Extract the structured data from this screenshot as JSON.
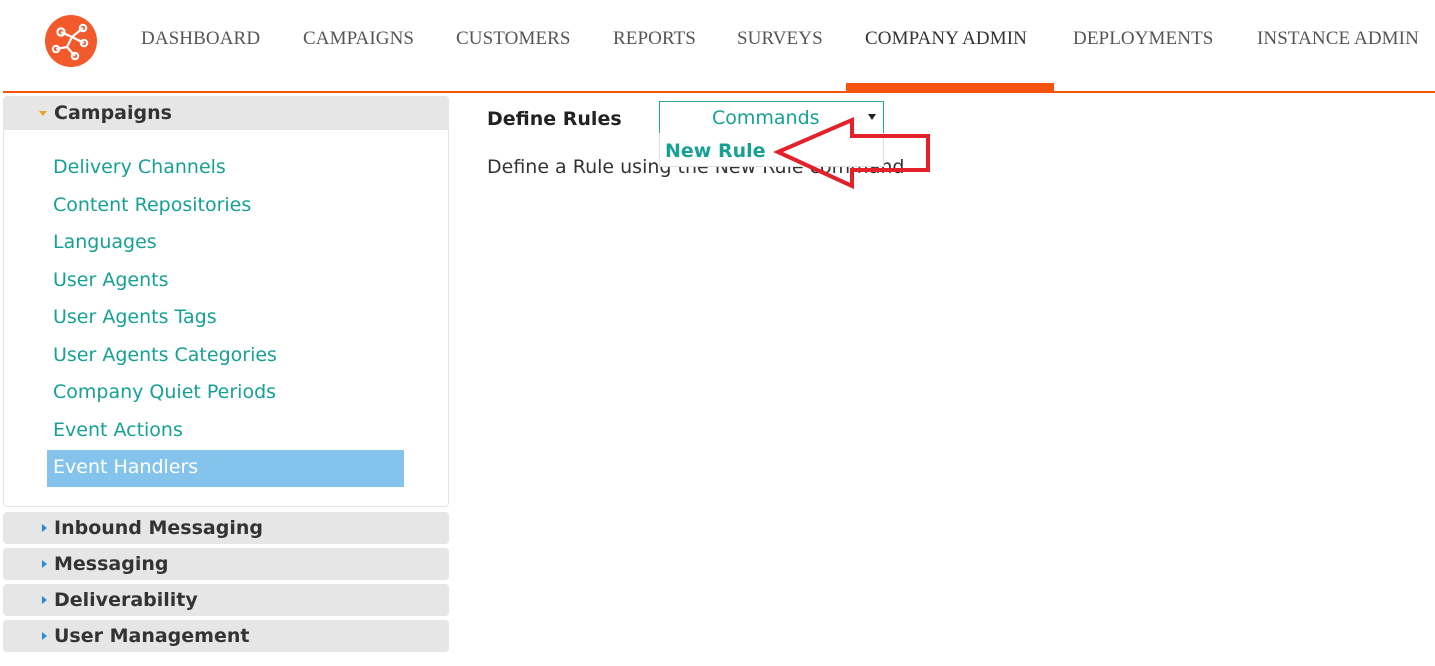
{
  "nav": {
    "items": [
      "DASHBOARD",
      "CAMPAIGNS",
      "CUSTOMERS",
      "REPORTS",
      "SURVEYS",
      "COMPANY ADMIN",
      "DEPLOYMENTS",
      "INSTANCE ADMIN"
    ],
    "active": "COMPANY ADMIN",
    "accent_color": "#f5520b"
  },
  "logo": {
    "icon": "molecule-network-icon",
    "color": "#f25a2b"
  },
  "sidebar": {
    "open_section": {
      "label": "Campaigns",
      "items": [
        "Delivery Channels",
        "Content Repositories",
        "Languages",
        "User Agents",
        "User Agents Tags",
        "User Agents Categories",
        "Company Quiet Periods",
        "Event Actions",
        "Event Handlers"
      ],
      "selected": "Event Handlers"
    },
    "collapsed_sections": [
      "Inbound Messaging",
      "Messaging",
      "Deliverability",
      "User Management"
    ],
    "link_color": "#17a094",
    "selected_color": "#83c3ec"
  },
  "main": {
    "title": "Define Rules",
    "description": "Define a Rule using the New Rule command",
    "commands": {
      "label": "Commands",
      "options": [
        "New Rule"
      ]
    }
  },
  "annotation": {
    "shape": "red-arrow",
    "color": "#e2212b"
  }
}
